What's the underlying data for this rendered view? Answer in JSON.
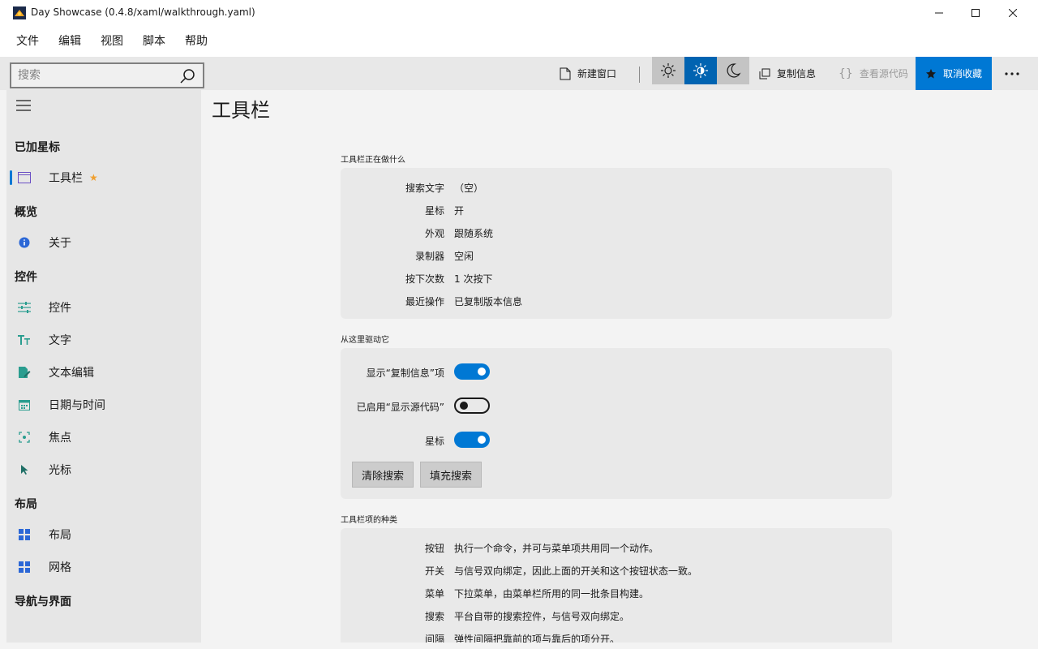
{
  "window": {
    "title": "Day Showcase (0.4.8/xaml/walkthrough.yaml)"
  },
  "menu": [
    "文件",
    "编辑",
    "视图",
    "脚本",
    "帮助"
  ],
  "toolbar": {
    "search_placeholder": "搜索",
    "new_window": "新建窗口",
    "copy_info": "复制信息",
    "view_source": "查看源代码",
    "unfavorite": "取消收藏",
    "theme_selected": "auto"
  },
  "sidebar": {
    "sections": [
      {
        "header": "已加星标",
        "items": [
          {
            "label": "工具栏",
            "icon": "window-icon",
            "starred": true,
            "selected": true
          }
        ]
      },
      {
        "header": "概览",
        "items": [
          {
            "label": "关于",
            "icon": "info-icon"
          }
        ]
      },
      {
        "header": "控件",
        "items": [
          {
            "label": "控件",
            "icon": "sliders-icon"
          },
          {
            "label": "文字",
            "icon": "text-icon"
          },
          {
            "label": "文本编辑",
            "icon": "edit-doc-icon"
          },
          {
            "label": "日期与时间",
            "icon": "calendar-icon"
          },
          {
            "label": "焦点",
            "icon": "focus-icon"
          },
          {
            "label": "光标",
            "icon": "cursor-icon"
          }
        ]
      },
      {
        "header": "布局",
        "items": [
          {
            "label": "布局",
            "icon": "layout-icon"
          },
          {
            "label": "网格",
            "icon": "grid-icon"
          }
        ]
      },
      {
        "header": "导航与界面",
        "items": []
      }
    ]
  },
  "content": {
    "title": "工具栏",
    "status_section": {
      "label": "工具栏正在做什么",
      "rows": [
        {
          "key": "搜索文字",
          "value": "（空）"
        },
        {
          "key": "星标",
          "value": "开"
        },
        {
          "key": "外观",
          "value": "跟随系统"
        },
        {
          "key": "录制器",
          "value": "空闲"
        },
        {
          "key": "按下次数",
          "value": "1 次按下"
        },
        {
          "key": "最近操作",
          "value": "已复制版本信息"
        }
      ]
    },
    "drive_section": {
      "label": "从这里驱动它",
      "toggles": [
        {
          "label": "显示“复制信息”项",
          "on": true
        },
        {
          "label": "已启用“显示源代码”",
          "on": false
        },
        {
          "label": "星标",
          "on": true
        }
      ],
      "clear_button": "清除搜索",
      "fill_button": "填充搜索"
    },
    "types_section": {
      "label": "工具栏项的种类",
      "rows": [
        {
          "key": "按钮",
          "value": "执行一个命令，并可与菜单项共用同一个动作。"
        },
        {
          "key": "开关",
          "value": "与信号双向绑定，因此上面的开关和这个按钮状态一致。"
        },
        {
          "key": "菜单",
          "value": "下拉菜单，由菜单栏所用的同一批条目构建。"
        },
        {
          "key": "搜索",
          "value": "平台自带的搜索控件，与信号双向绑定。"
        },
        {
          "key": "间隔",
          "value": "弹性间隔把靠前的项与靠后的项分开。"
        }
      ]
    }
  }
}
